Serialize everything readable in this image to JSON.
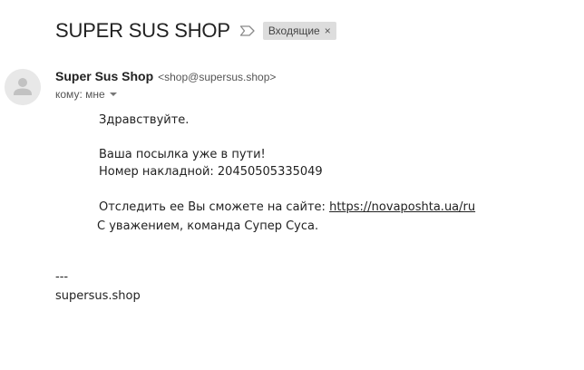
{
  "email": {
    "subject": "SUPER SUS SHOP",
    "label": "Входящие",
    "label_close": "×",
    "sender_name": "Super Sus Shop",
    "sender_email": "<shop@supersus.shop>",
    "recipient": "кому: мне",
    "body": {
      "greeting": "Здравствуйте.",
      "line1": "Ваша посылка уже в пути!",
      "line2": "Номер накладной: 20450505335049",
      "track_prefix": "Отследить ее Вы сможете на сайте: ",
      "track_link": "https://novaposhta.ua/ru",
      "regards": "С уважением, команда Супер Суса."
    },
    "signature": {
      "separator": "---",
      "domain": "supersus.shop"
    }
  },
  "icons": {
    "important": "important-marker-icon",
    "avatar": "default-avatar-icon",
    "recipient_toggle": "caret-down-icon"
  },
  "colors": {
    "label_chip_bg": "#dddddd",
    "avatar_bg": "#e8e8e8",
    "text": "#222222"
  }
}
